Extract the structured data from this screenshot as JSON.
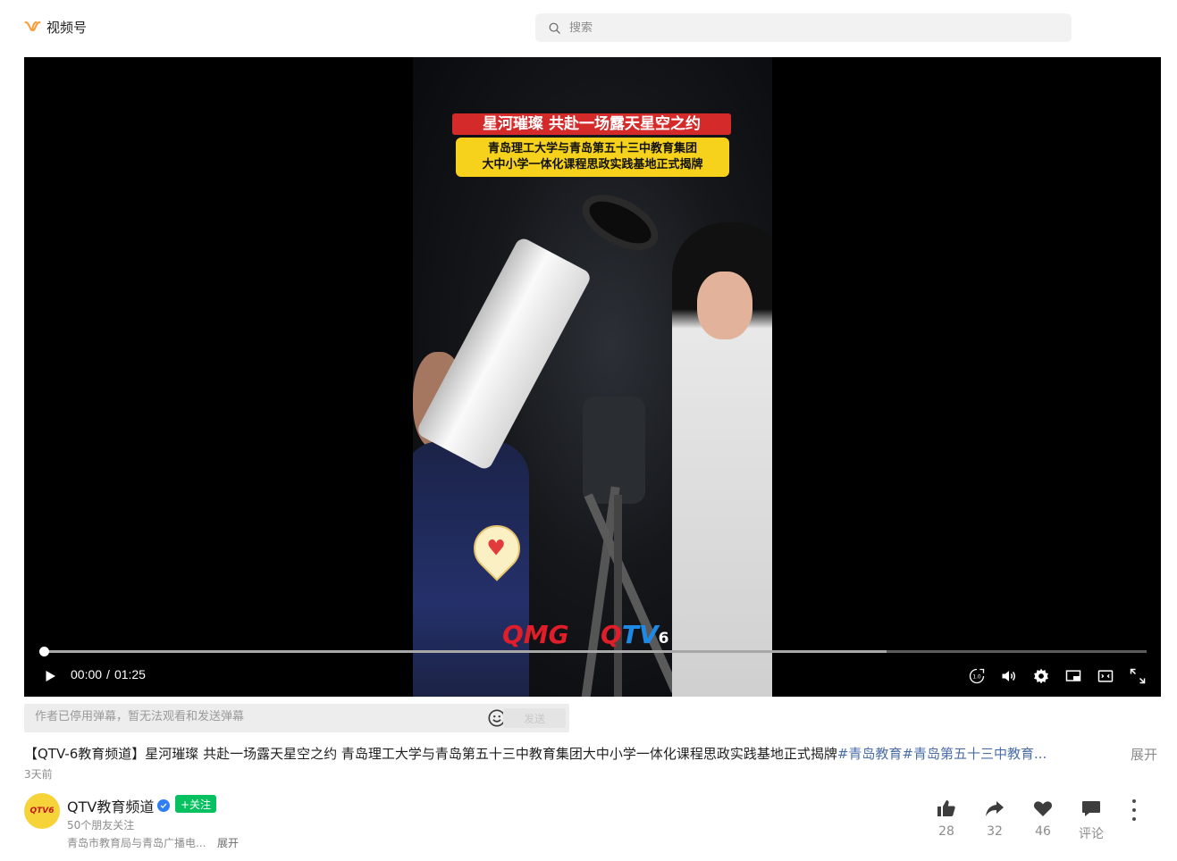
{
  "app": {
    "name": "视频号"
  },
  "search": {
    "placeholder": "搜索"
  },
  "video": {
    "caption_title": "星河璀璨 共赴一场露天星空之约",
    "caption_line1": "青岛理工大学与青岛第五十三中教育集团",
    "caption_line2": "大中小学一体化课程思政实践基地正式揭牌",
    "watermark_qmg": "QMG",
    "watermark_qtv_q": "Q",
    "watermark_qtv_tv": "TV",
    "watermark_qtv_num": "6"
  },
  "player": {
    "current_time": "00:00",
    "separator": "/",
    "duration": "01:25",
    "progress_fraction": 0.0,
    "buffered_fraction": 0.765
  },
  "danmaku": {
    "placeholder": "作者已停用弹幕，暂无法观看和发送弹幕",
    "send_label": "发送"
  },
  "post": {
    "description": "【QTV-6教育频道】星河璀璨 共赴一场露天星空之约 青岛理工大学与青岛第五十三中教育集团大中小学一体化课程思政实践基地正式揭牌",
    "hashtags": "#青岛教育#青岛第五十三中教育...",
    "expand_label": "展开",
    "date": "3天前"
  },
  "author": {
    "avatar_text": "QTV6",
    "name": "QTV教育频道",
    "follow_label": "+关注",
    "friends": "50个朋友关注",
    "bio": "青岛市教育局与青岛广播电...",
    "expand_label": "展开"
  },
  "actions": {
    "like_count": "28",
    "share_count": "32",
    "favorite_count": "46",
    "comment_label": "评论"
  },
  "colors": {
    "brand_orange": "#fa9d3b",
    "follow_green": "#07c160",
    "hashtag_blue": "#4b6ea8"
  }
}
